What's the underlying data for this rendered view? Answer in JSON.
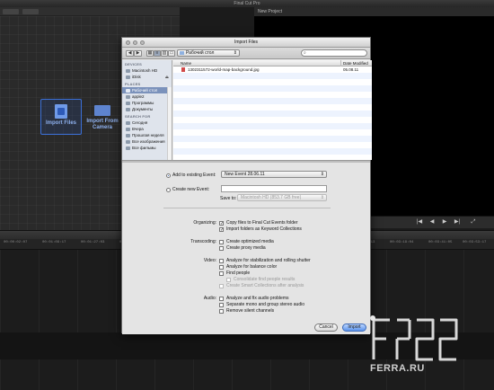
{
  "app": {
    "title": "Final Cut Pro",
    "viewer_title": "New Project",
    "tiles": {
      "import_files": "Import Files",
      "import_from_camera_line1": "Import From",
      "import_from_camera_line2": "Camera"
    },
    "timeline_ticks": [
      "00:00:02:07",
      "00:01:09:17",
      "00:01:27:03",
      "00:01:44:13",
      "00:01:59:18",
      "00:02:11:17",
      "00:02:19:13",
      "00:02:41:07",
      "00:02:51:09",
      "00:03:07:13",
      "00:03:19:04",
      "00:03:41:05",
      "00:03:53:17"
    ]
  },
  "dialog": {
    "title": "Import Files",
    "path_popup": "Рабочий стол",
    "search_placeholder": "",
    "sidebar": {
      "devices_head": "DEVICES",
      "devices": [
        "Macintosh HD",
        "iDisk"
      ],
      "places_head": "PLACES",
      "places": [
        "Рабочий стол",
        "apple2",
        "Программы",
        "Документы"
      ],
      "search_head": "SEARCH FOR",
      "searches": [
        "Сегодня",
        "Вчера",
        "Прошлая неделя",
        "Все изображения",
        "Все фильмы"
      ]
    },
    "columns": {
      "name": "Name",
      "date": "Date Modified"
    },
    "files": [
      {
        "name": "1302311572-world-map-background.jpg",
        "date": "05.08.11"
      }
    ],
    "add_existing_label": "Add to existing Event:",
    "existing_event_value": "New Event 28.06.11",
    "create_new_label": "Create new Event:",
    "save_to_label": "Save to:",
    "save_to_value": "Macintosh HD  (853.7 GB free)",
    "organizing": {
      "label": "Organizing:",
      "copy": "Copy files to Final Cut Events folder",
      "keywords": "Import folders as Keyword Collections"
    },
    "transcoding": {
      "label": "Transcoding:",
      "optimized": "Create optimized media",
      "proxy": "Create proxy media"
    },
    "video": {
      "label": "Video:",
      "stabilization": "Analyze for stabilization and rolling shutter",
      "balance": "Analyze for balance color",
      "find_people": "Find people",
      "consolidate": "Consolidate find people results",
      "smart": "Create Smart Collections after analysis"
    },
    "audio": {
      "label": "Audio:",
      "fix": "Analyze and fix audio problems",
      "separate": "Separate mono and group stereo audio",
      "remove": "Remove silent channels"
    },
    "cancel_label": "Cancel",
    "import_label": "Import"
  },
  "watermark": {
    "text": "FERRA.RU"
  },
  "colors": {
    "selection": "#3b6fd6",
    "sidebar_selected": "#7b92bb",
    "default_button": "#5b93ea"
  }
}
